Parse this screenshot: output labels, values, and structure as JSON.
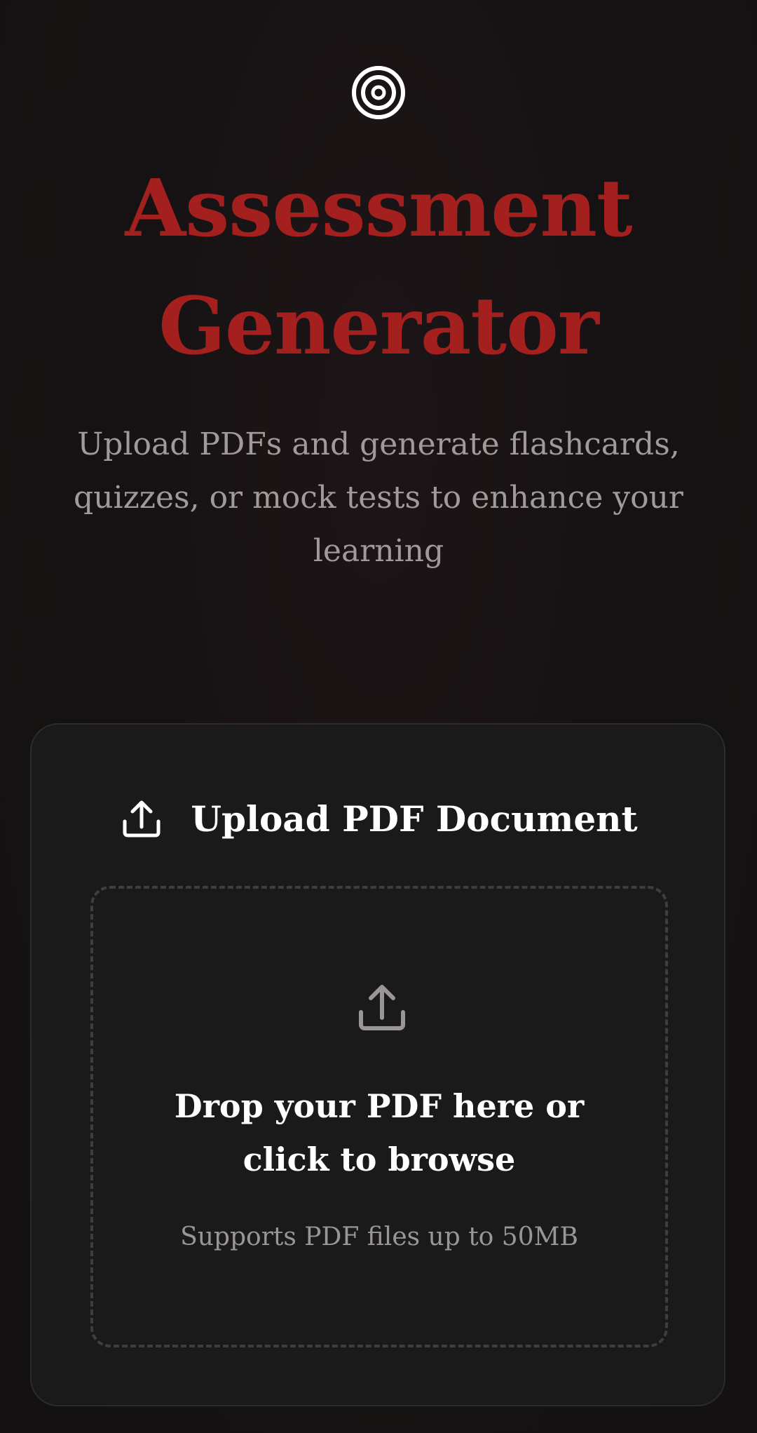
{
  "logo": {
    "icon": "target-icon"
  },
  "hero": {
    "title_line1": "Assessment",
    "title_line2": "Generator",
    "subtitle": "Upload PDFs and generate flashcards, quizzes, or mock tests to enhance your learning"
  },
  "upload_card": {
    "icon": "upload-icon",
    "title": "Upload PDF Document",
    "dropzone": {
      "icon": "upload-icon",
      "primary_line1": "Drop your PDF here or",
      "primary_line2": "click to browse",
      "hint": "Supports PDF files up to 50MB"
    }
  },
  "colors": {
    "background": "#151112",
    "title_accent": "#a3201f",
    "card_background": "#1b1a1b",
    "muted_text": "#a09a9b"
  }
}
